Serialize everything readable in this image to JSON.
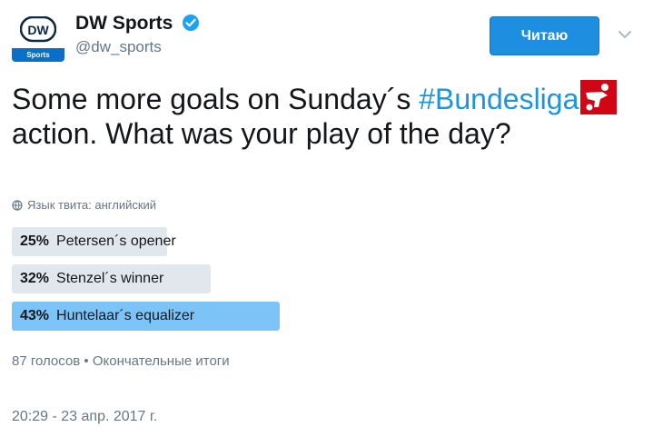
{
  "author": {
    "name": "DW Sports",
    "handle": "@dw_sports",
    "avatar_text": "DW",
    "avatar_label": "Sports",
    "verified_icon": "verified-badge-icon"
  },
  "follow_button": {
    "label": "Читаю"
  },
  "tweet": {
    "text_before": "Some more goals on Sunday´s ",
    "hashtag": "#Bundesliga",
    "text_after": " action. What was your play of the day?"
  },
  "language_note": "Язык твита: английский",
  "poll": {
    "choices": [
      {
        "percent": "25%",
        "percent_value": 25,
        "label": "Petersen´s opener",
        "winner": false
      },
      {
        "percent": "32%",
        "percent_value": 32,
        "label": "Stenzel´s winner",
        "winner": false
      },
      {
        "percent": "43%",
        "percent_value": 43,
        "label": "Huntelaar´s equalizer",
        "winner": true
      }
    ],
    "meta": "87 голосов • Окончательные итоги"
  },
  "timestamp": "20:29 - 23 апр. 2017 г.",
  "colors": {
    "accent": "#1b95e0",
    "follow_button": "#1e8fe0",
    "poll_bar": "#e1e8ed",
    "poll_winner_bar": "#7cc4f7",
    "bundesliga_red": "#d20515"
  }
}
